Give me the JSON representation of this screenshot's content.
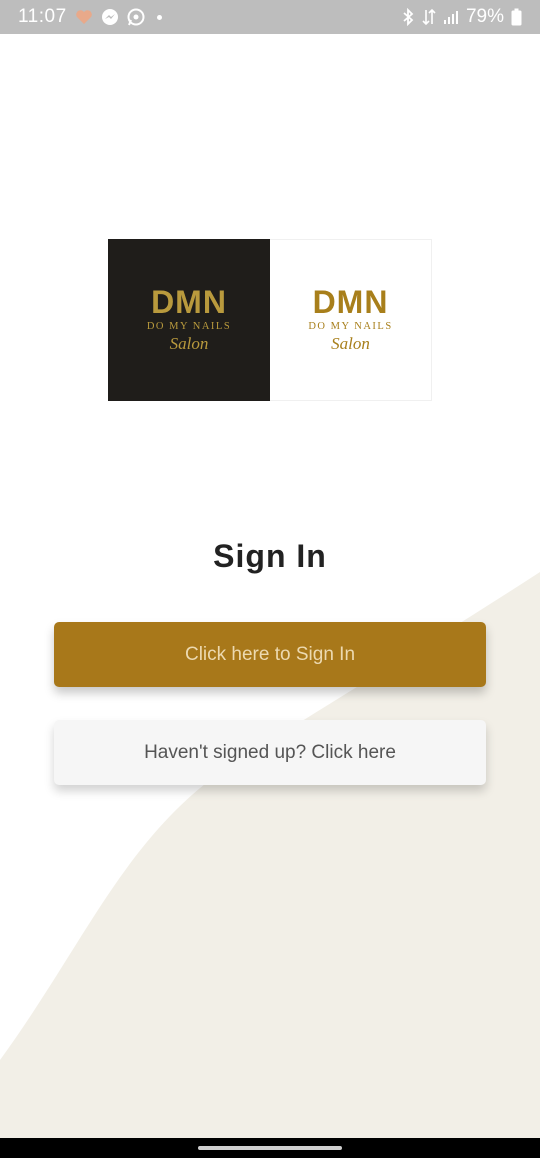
{
  "status_bar": {
    "time": "11:07",
    "battery_text": "79%",
    "left_icons": [
      "heart-icon",
      "messenger-icon",
      "whatsapp-icon",
      "notification-dot"
    ],
    "right_icons": [
      "bluetooth-icon",
      "data-arrows-icon",
      "signal-icon",
      "battery-icon"
    ]
  },
  "logo": {
    "dark": {
      "mark": "DMN",
      "subtitle": "DO MY NAILS",
      "script": "Salon"
    },
    "light": {
      "mark": "DMN",
      "subtitle": "DO MY NAILS",
      "script": "Salon"
    }
  },
  "page": {
    "title": "Sign In"
  },
  "buttons": {
    "sign_in_label": "Click here to Sign In",
    "sign_up_label": "Haven't signed up? Click here"
  },
  "colors": {
    "accent": "#a8781a",
    "accent_text": "#ecd9b0",
    "swoosh": "#f2efe7",
    "status_bar": "#bdbdbd"
  }
}
